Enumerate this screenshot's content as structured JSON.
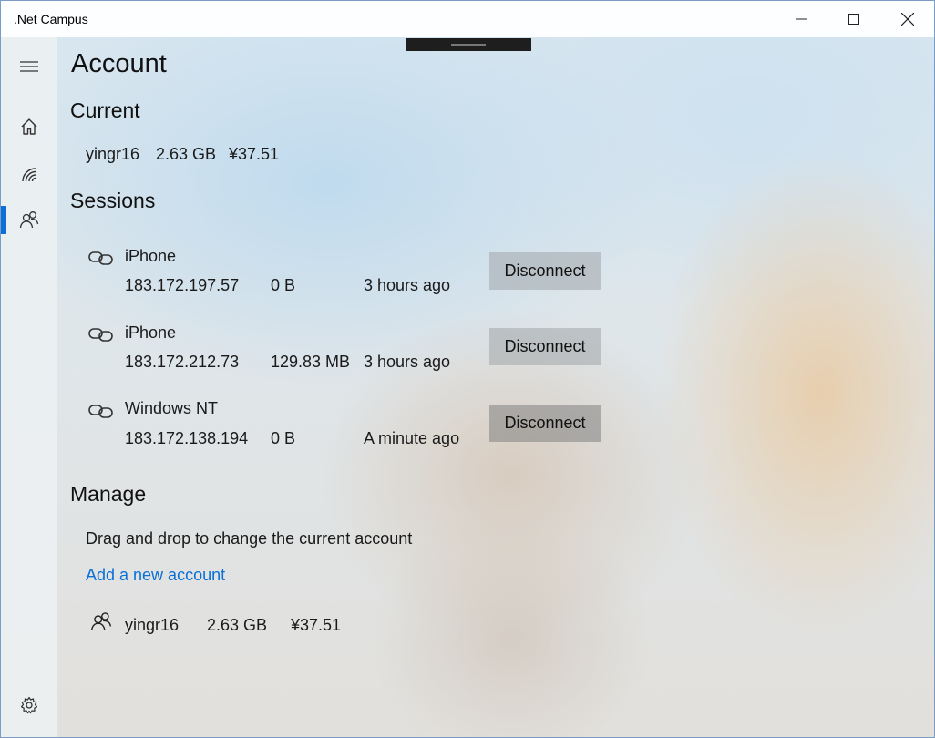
{
  "window": {
    "title": ".Net Campus"
  },
  "nav": {
    "items": [
      {
        "icon": "hamburger-menu-icon"
      },
      {
        "icon": "home-icon"
      },
      {
        "icon": "wifi-signal-icon"
      },
      {
        "icon": "people-icon",
        "selected": true
      },
      {
        "icon": "gear-icon"
      }
    ],
    "accent": "#0b6fd6"
  },
  "page": {
    "title": "Account"
  },
  "current": {
    "heading": "Current",
    "username": "yingr16",
    "usage": "2.63 GB",
    "balance": "¥37.51"
  },
  "sessions": {
    "heading": "Sessions",
    "items": [
      {
        "device": "iPhone",
        "ip": "183.172.197.57",
        "traffic": "0 B",
        "time": "3 hours ago",
        "action": "Disconnect"
      },
      {
        "device": "iPhone",
        "ip": "183.172.212.73",
        "traffic": "129.83 MB",
        "time": "3 hours ago",
        "action": "Disconnect"
      },
      {
        "device": "Windows NT",
        "ip": "183.172.138.194",
        "traffic": "0 B",
        "time": "A minute ago",
        "action": "Disconnect"
      }
    ]
  },
  "manage": {
    "heading": "Manage",
    "hint": "Drag and drop to change the current account",
    "add_link": "Add a new account",
    "accounts": [
      {
        "username": "yingr16",
        "usage": "2.63 GB",
        "balance": "¥37.51"
      }
    ]
  }
}
